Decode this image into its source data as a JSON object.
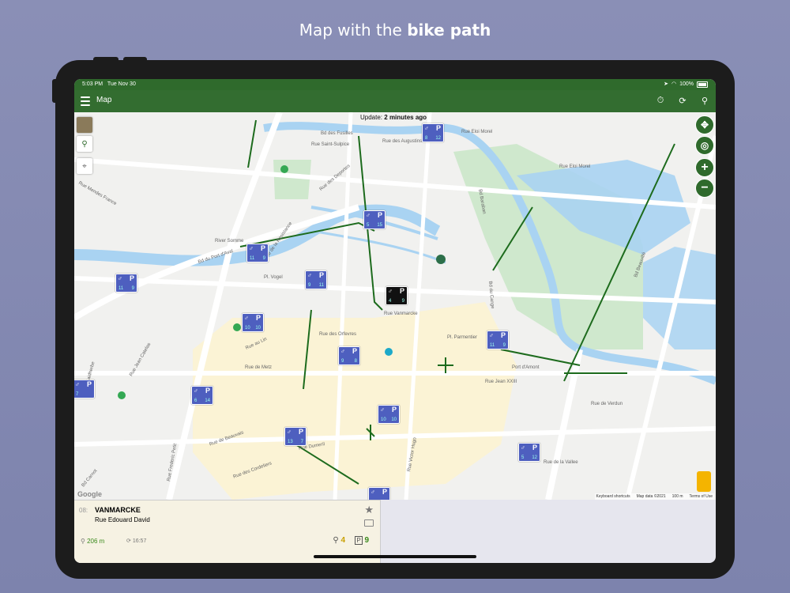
{
  "headline": {
    "plain": "Map with the ",
    "bold": "bike path"
  },
  "status": {
    "time": "5:03 PM",
    "date": "Tue Nov 30",
    "battery": "100%"
  },
  "appbar": {
    "title": "Map"
  },
  "map": {
    "update_label": "Update:",
    "update_value": "2 minutes ago",
    "streets": [
      "Bd des Fusilles",
      "Rue Saint-Sulpice",
      "Rue des Deportes",
      "Rue des Augustins",
      "Rue Eloi Morel",
      "Rue Eloi Morel",
      "Rue Mendes France",
      "River Somme",
      "Bd du Port d'Aval",
      "Rue de la Resistance",
      "Pl. Vogel",
      "Rue Vanmarcke",
      "Pl. Parmentier",
      "Rue au Lin",
      "Rue des Orfevres",
      "Rue de Metz",
      "Rue Jean Catelas",
      "Bd Faidherbe",
      "Rue de Beauvais",
      "Rue Dumeril",
      "Rue Victor Hugo",
      "Bd du Cange",
      "Rue de Verdun",
      "Rue Jean XXIII",
      "Bd Beauvillé",
      "Bd Baraban",
      "Port d'Amont",
      "Rue des Cordeliers",
      "Bd Carnot",
      "Rue Frederic Petit",
      "Rue de la Vallee"
    ],
    "pins": [
      {
        "a": "8",
        "d": "12"
      },
      {
        "a": "5",
        "d": "15"
      },
      {
        "a": "11",
        "d": "9"
      },
      {
        "a": "11",
        "d": "9"
      },
      {
        "a": "9",
        "d": "11"
      },
      {
        "a": "4",
        "d": "9"
      },
      {
        "a": "10",
        "d": "10"
      },
      {
        "a": "11",
        "d": "9"
      },
      {
        "a": "9",
        "d": "8"
      },
      {
        "a": "7",
        "d": ""
      },
      {
        "a": "6",
        "d": "14"
      },
      {
        "a": "10",
        "d": "10"
      },
      {
        "a": "13",
        "d": "7"
      },
      {
        "a": "5",
        "d": "12"
      },
      {
        "a": "",
        "d": ""
      }
    ],
    "footer": {
      "shortcuts": "Keyboard shortcuts",
      "mapdata": "Map data ©2021",
      "scale": "100 m",
      "terms": "Terms of Use"
    },
    "google": "Google"
  },
  "info": {
    "number": "08:",
    "name": "VANMARCKE",
    "address": "Rue Edouard David",
    "distance": "206 m",
    "time": "16:57",
    "bikes": "4",
    "docks": "9"
  },
  "colors": {
    "primary": "#336d30",
    "pin": "#4e5fbf",
    "water": "#a9d3f2",
    "park": "#c8e6c9",
    "bike_path": "#1d6b1d"
  }
}
